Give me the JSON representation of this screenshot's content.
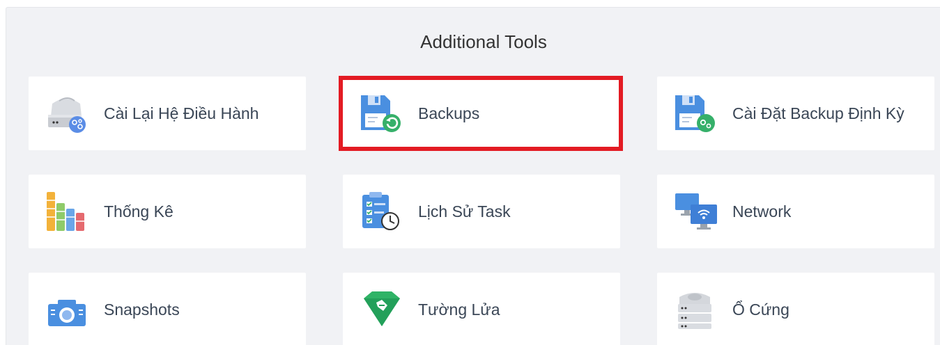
{
  "panel": {
    "title": "Additional Tools"
  },
  "tools": [
    {
      "label": "Cài Lại Hệ Điều Hành",
      "icon": "reinstall-os-icon"
    },
    {
      "label": "Backups",
      "icon": "backup-icon",
      "highlighted": true
    },
    {
      "label": "Cài Đặt Backup Định Kỳ",
      "icon": "scheduled-backup-icon"
    },
    {
      "label": "Thống Kê",
      "icon": "statistics-icon"
    },
    {
      "label": "Lịch Sử Task",
      "icon": "task-history-icon"
    },
    {
      "label": "Network",
      "icon": "network-icon"
    },
    {
      "label": "Snapshots",
      "icon": "snapshot-icon"
    },
    {
      "label": "Tường Lửa",
      "icon": "firewall-icon"
    },
    {
      "label": "Ổ Cứng",
      "icon": "disk-icon"
    }
  ],
  "colors": {
    "highlight": "#e31b23",
    "panel_bg": "#f1f2f5",
    "tile_bg": "#ffffff",
    "label": "#3a4656",
    "blue": "#4a8fe0",
    "green": "#3db56a"
  }
}
